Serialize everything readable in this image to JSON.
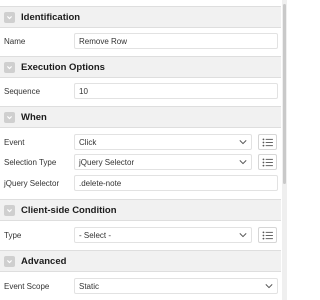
{
  "sections": {
    "identification": {
      "title": "Identification"
    },
    "execution": {
      "title": "Execution Options"
    },
    "when": {
      "title": "When"
    },
    "condition": {
      "title": "Client-side Condition"
    },
    "advanced": {
      "title": "Advanced"
    }
  },
  "fields": {
    "name": {
      "label": "Name",
      "value": "Remove Row"
    },
    "sequence": {
      "label": "Sequence",
      "value": "10"
    },
    "event": {
      "label": "Event",
      "value": "Click"
    },
    "selection_type": {
      "label": "Selection Type",
      "value": "jQuery Selector"
    },
    "jquery_selector": {
      "label": "jQuery Selector",
      "value": ".delete-note"
    },
    "type": {
      "label": "Type",
      "value": "- Select -"
    },
    "event_scope": {
      "label": "Event Scope",
      "value": "Static"
    }
  },
  "icons": {
    "collapse": "chevron-down-icon",
    "list": "list-icon",
    "dropdown": "chevron-down-icon"
  }
}
